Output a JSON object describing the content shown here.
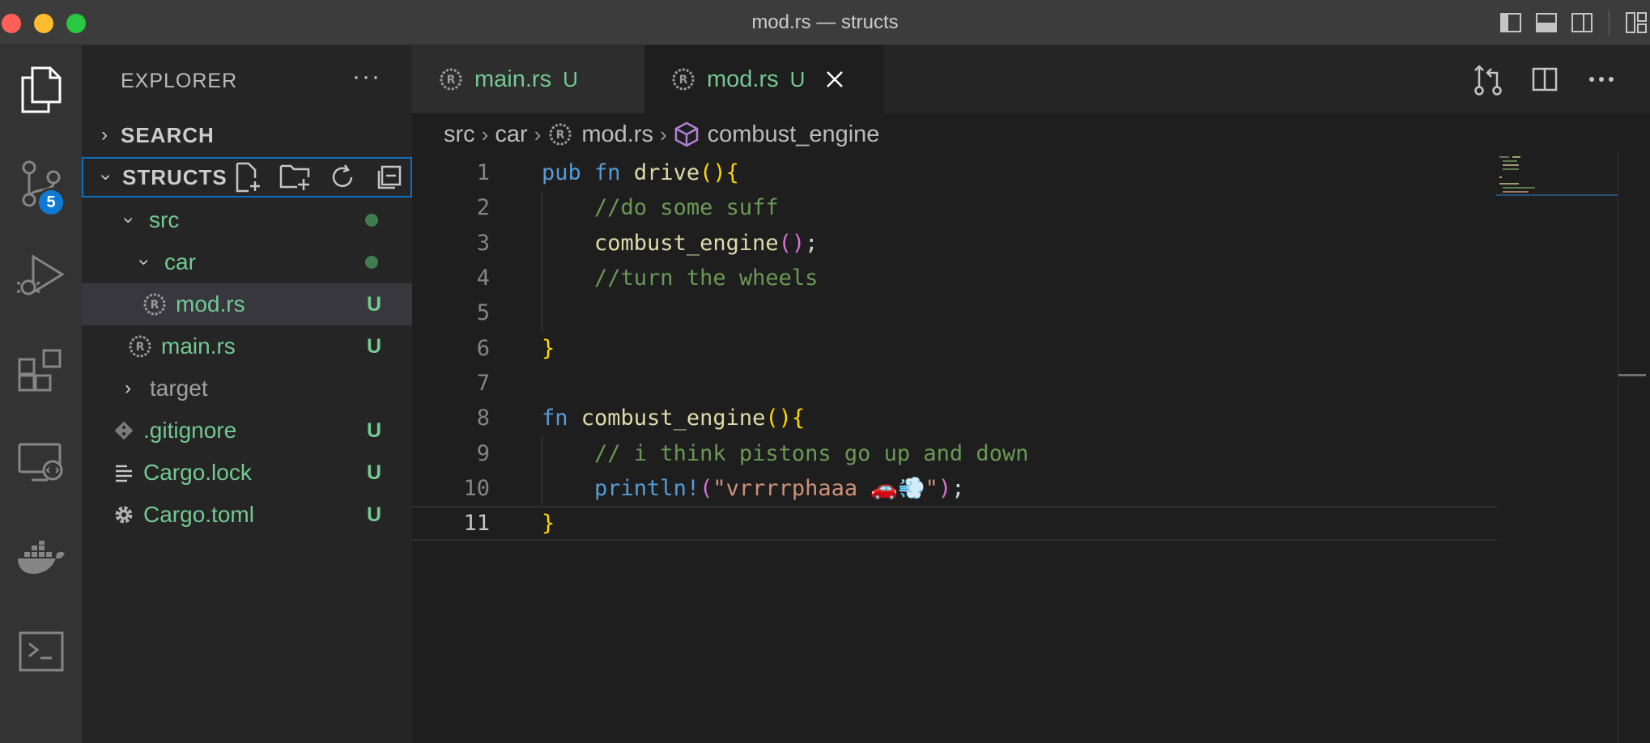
{
  "window": {
    "title": "mod.rs — structs"
  },
  "activity_bar": {
    "items": [
      {
        "icon": "files-icon"
      },
      {
        "icon": "source-control-icon",
        "badge": "5"
      },
      {
        "icon": "run-debug-icon"
      },
      {
        "icon": "extensions-icon"
      },
      {
        "icon": "remote-explorer-icon"
      },
      {
        "icon": "docker-icon"
      },
      {
        "icon": "terminal-icon"
      }
    ]
  },
  "sidebar": {
    "header": "EXPLORER",
    "more": "···",
    "search_section": "SEARCH",
    "workspace_section": "STRUCTS",
    "tree": [
      {
        "label": "src",
        "status": "dot"
      },
      {
        "label": "car",
        "status": "dot"
      },
      {
        "label": "mod.rs",
        "status": "U"
      },
      {
        "label": "main.rs",
        "status": "U"
      },
      {
        "label": "target",
        "status": ""
      },
      {
        "label": ".gitignore",
        "status": "U"
      },
      {
        "label": "Cargo.lock",
        "status": "U"
      },
      {
        "label": "Cargo.toml",
        "status": "U"
      }
    ]
  },
  "tabs": [
    {
      "label": "main.rs",
      "status": "U"
    },
    {
      "label": "mod.rs",
      "status": "U"
    }
  ],
  "breadcrumbs": {
    "items": [
      "src",
      "car",
      "mod.rs",
      "combust_engine"
    ]
  },
  "editor": {
    "line_numbers": [
      "1",
      "2",
      "3",
      "4",
      "5",
      "6",
      "7",
      "8",
      "9",
      "10",
      "11"
    ],
    "tokens": {
      "l1_pub": "pub",
      "l1_fn": "fn",
      "l1_name": "drive",
      "l1_paren": "()",
      "l1_brace": "{",
      "l2_comment": "//do some suff",
      "l3_call": "combust_engine",
      "l3_paren": "()",
      "l3_semi": ";",
      "l4_comment": "//turn the wheels",
      "l6_brace": "}",
      "l8_fn": "fn",
      "l8_name": "combust_engine",
      "l8_paren": "()",
      "l8_brace": "{",
      "l9_comment": "// i think pistons go up and down",
      "l10_macro": "println",
      "l10_bang": "!",
      "l10_open": "(",
      "l10_string": "\"vrrrrphaaa 🚗💨\"",
      "l10_close": ")",
      "l10_semi": ";",
      "l11_brace": "}"
    }
  },
  "colors": {
    "git_untracked": "#73c991",
    "keyword": "#569cd6",
    "function": "#dcdcaa",
    "comment": "#6a9955",
    "string": "#ce9178",
    "bracket_gold": "#ffd700",
    "bracket_pink": "#da70d6",
    "accent": "#0e70c0"
  }
}
